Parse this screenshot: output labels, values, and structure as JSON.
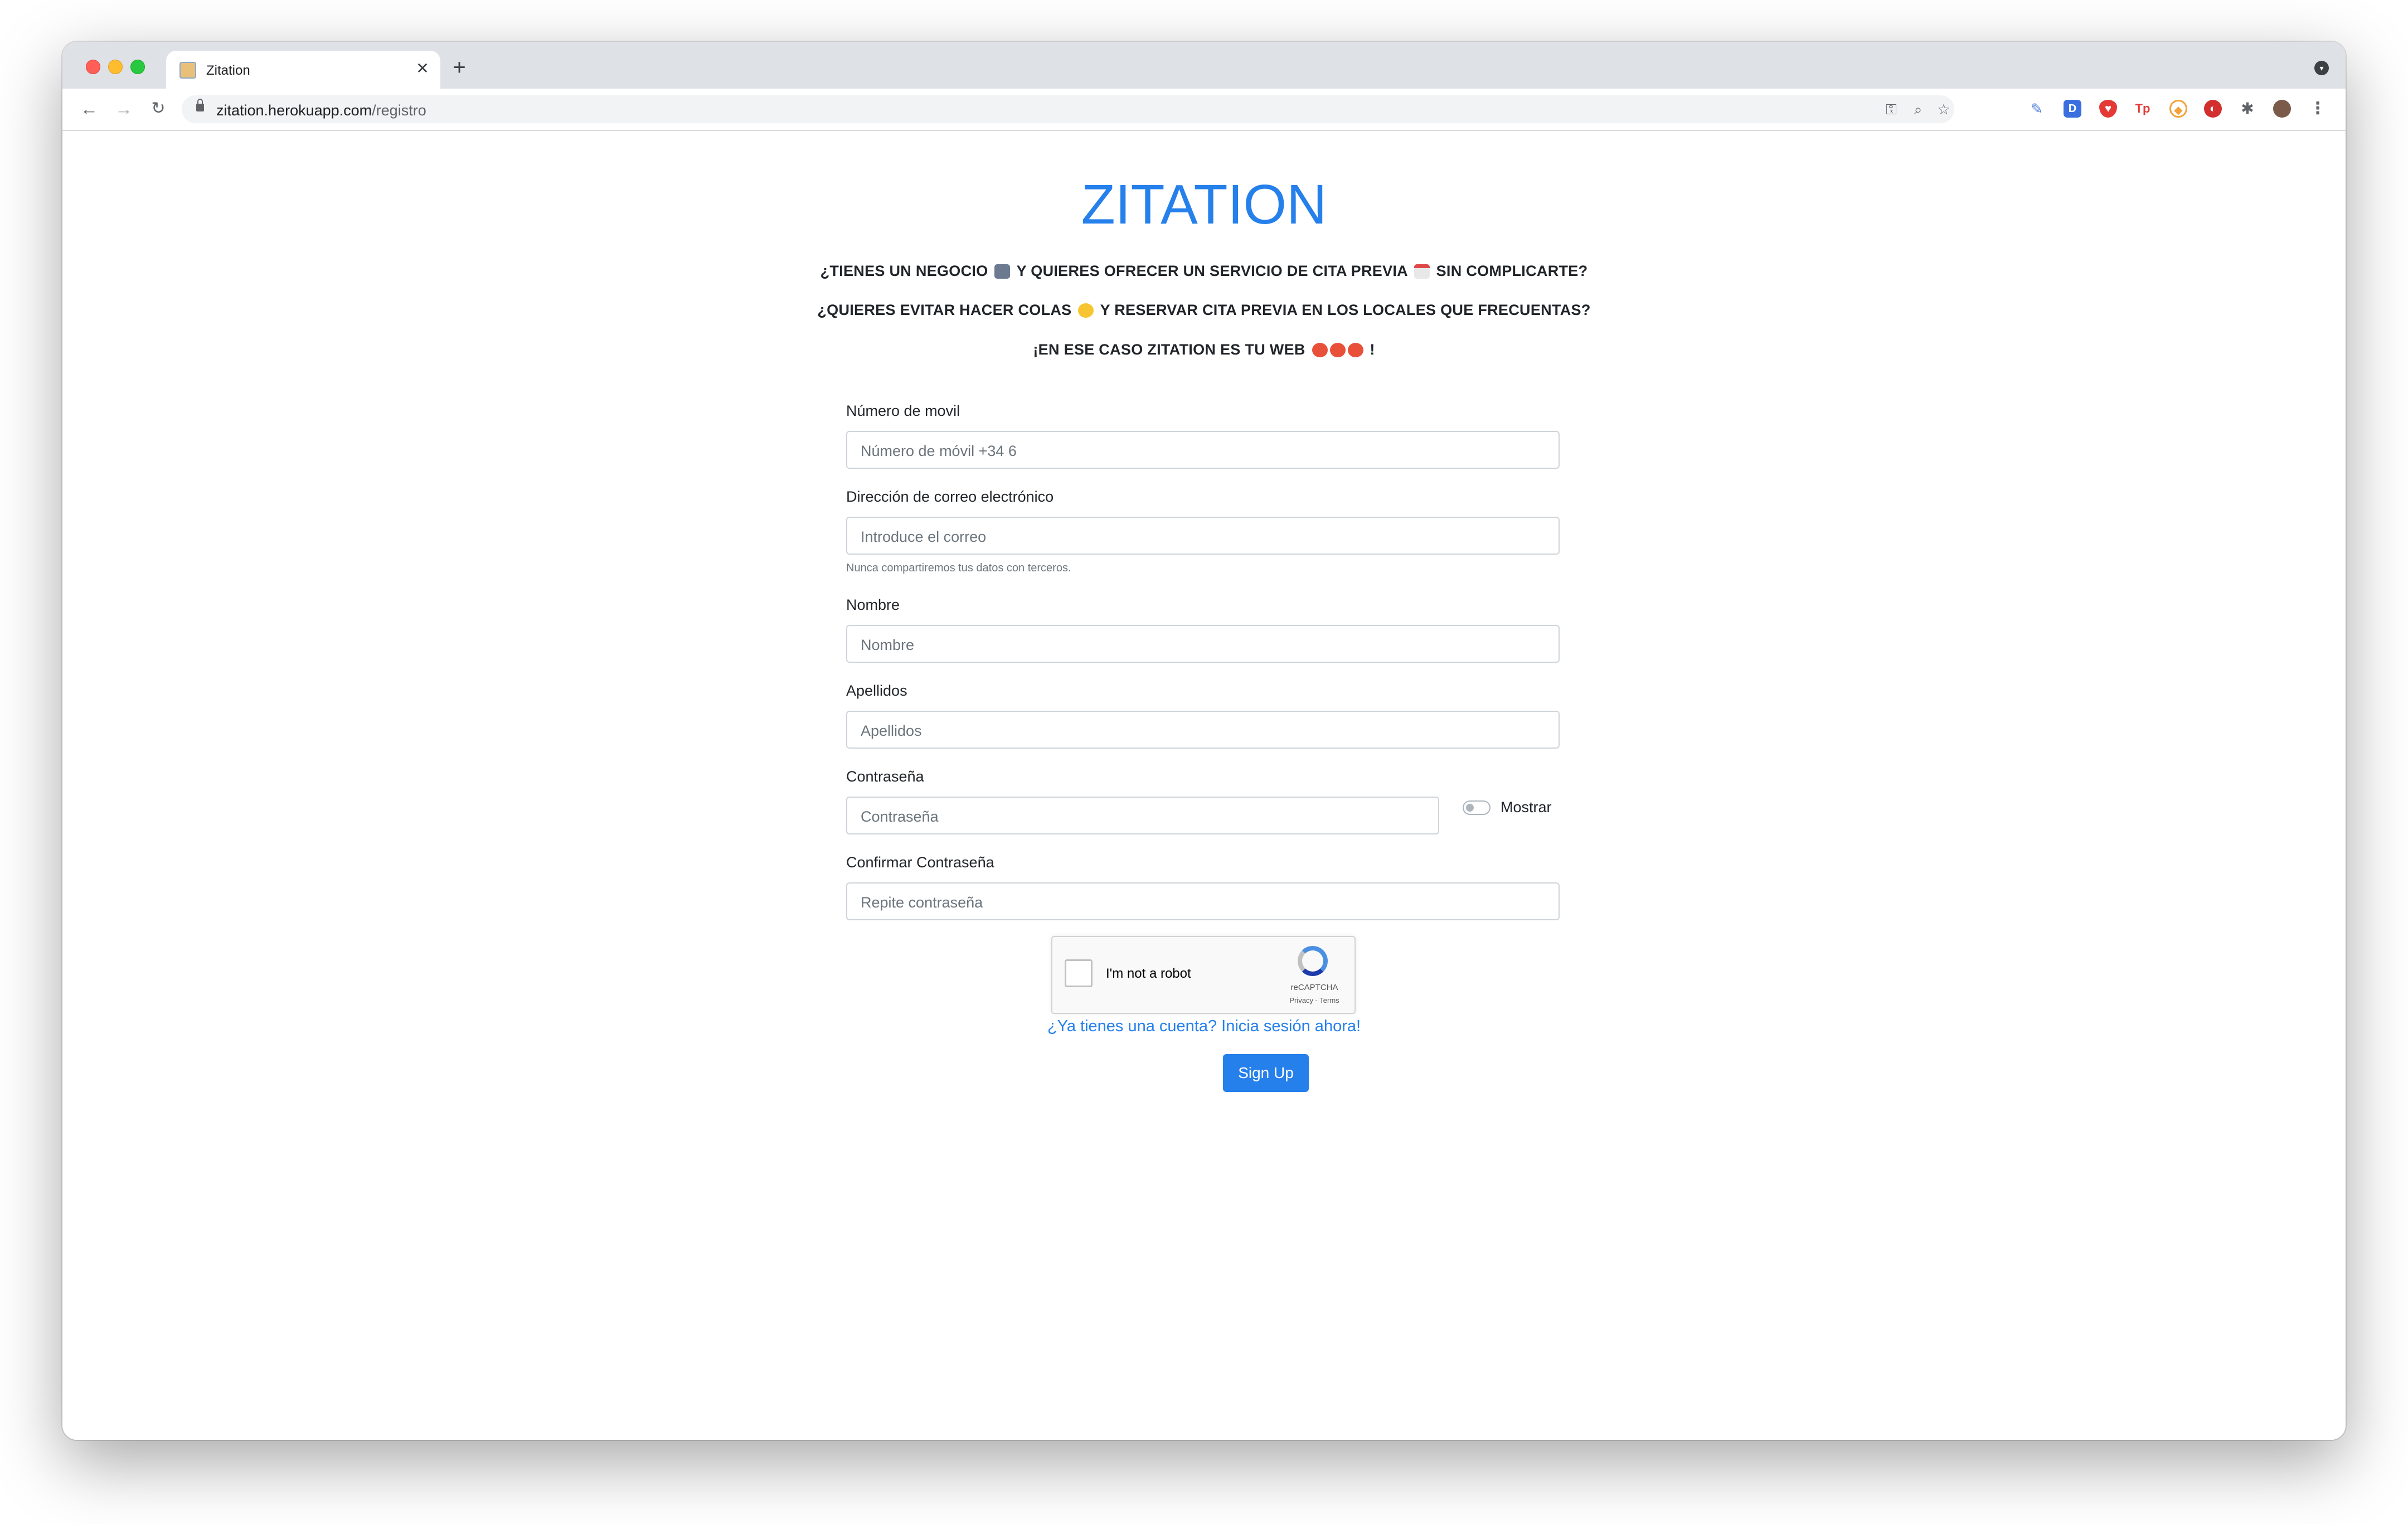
{
  "browser": {
    "tab_title": "Zitation",
    "new_tab_symbol": "+",
    "close_symbol": "✕",
    "url_host": "zitation.herokuapp.com",
    "url_path": "/registro",
    "extensions": [
      "D",
      "Tp"
    ]
  },
  "page": {
    "logo": "ZITATION",
    "tagline_1a": "¿TIENES UN NEGOCIO",
    "tagline_1b": "Y QUIERES OFRECER UN SERVICIO DE CITA PREVIA",
    "tagline_1c": "SIN COMPLICARTE?",
    "tagline_2a": "¿QUIERES EVITAR HACER COLAS",
    "tagline_2b": "Y RESERVAR CITA PREVIA EN LOS LOCALES QUE FRECUENTAS?",
    "tagline_3a": "¡EN ESE CASO ZITATION ES TU WEB",
    "tagline_3b": "!"
  },
  "form": {
    "phone": {
      "label": "Número de movil",
      "placeholder": "Número de móvil +34 6"
    },
    "email": {
      "label": "Dirección de correo electrónico",
      "placeholder": "Introduce el correo",
      "help": "Nunca compartiremos tus datos con terceros."
    },
    "name": {
      "label": "Nombre",
      "placeholder": "Nombre"
    },
    "surname": {
      "label": "Apellidos",
      "placeholder": "Apellidos"
    },
    "password": {
      "label": "Contraseña",
      "placeholder": "Contraseña",
      "toggle_label": "Mostrar"
    },
    "confirm": {
      "label": "Confirmar Contraseña",
      "placeholder": "Repite contraseña"
    },
    "recaptcha": {
      "text": "I'm not a robot",
      "brand": "reCAPTCHA",
      "terms": "Privacy - Terms"
    },
    "login_link": "¿Ya tienes una cuenta? Inicia sesión ahora!",
    "submit": "Sign Up"
  },
  "colors": {
    "accent": "#2680eb"
  }
}
